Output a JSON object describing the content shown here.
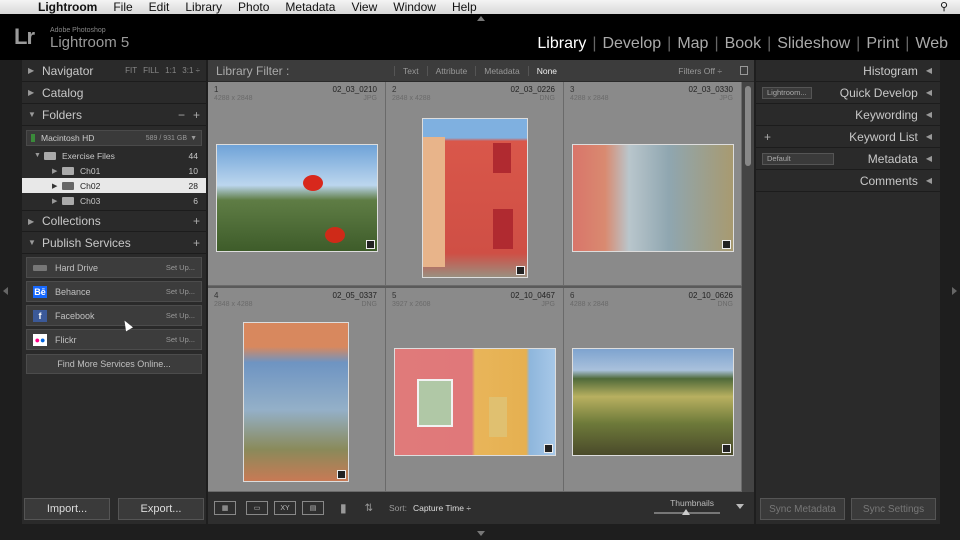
{
  "menubar": {
    "app": "Lightroom",
    "items": [
      "File",
      "Edit",
      "Library",
      "Photo",
      "Metadata",
      "View",
      "Window",
      "Help"
    ]
  },
  "branding": {
    "logo": "Lr",
    "small": "Adobe Photoshop",
    "big": "Lightroom 5"
  },
  "modules": [
    "Library",
    "Develop",
    "Map",
    "Book",
    "Slideshow",
    "Print",
    "Web"
  ],
  "left_panel": {
    "navigator": {
      "title": "Navigator",
      "zoom": [
        "FIT",
        "FILL",
        "1:1",
        "3:1 ÷"
      ]
    },
    "catalog": "Catalog",
    "folders": {
      "title": "Folders",
      "drive": {
        "name": "Macintosh HD",
        "capacity": "589 / 931 GB"
      },
      "items": [
        {
          "name": "Exercise Files",
          "count": "44"
        },
        {
          "name": "Ch01",
          "count": "10"
        },
        {
          "name": "Ch02",
          "count": "28"
        },
        {
          "name": "Ch03",
          "count": "6"
        }
      ]
    },
    "collections": "Collections",
    "publish": {
      "title": "Publish Services",
      "services": [
        {
          "name": "Hard Drive",
          "setup": "Set Up..."
        },
        {
          "name": "Behance",
          "setup": "Set Up..."
        },
        {
          "name": "Facebook",
          "setup": "Set Up..."
        },
        {
          "name": "Flickr",
          "setup": "Set Up..."
        }
      ],
      "find_more": "Find More Services Online..."
    },
    "import": "Import...",
    "export": "Export..."
  },
  "right_panel": {
    "histogram": "Histogram",
    "quick_develop": {
      "title": "Quick Develop",
      "preset": "Lightroom..."
    },
    "keywording": "Keywording",
    "keyword_list": "Keyword List",
    "metadata": {
      "title": "Metadata",
      "preset": "Default"
    },
    "comments": "Comments",
    "sync_metadata": "Sync Metadata",
    "sync_settings": "Sync Settings"
  },
  "filter": {
    "title": "Library Filter :",
    "tabs": [
      "Text",
      "Attribute",
      "Metadata",
      "None"
    ],
    "active": "None",
    "filters_off": "Filters Off ÷"
  },
  "photos": [
    {
      "num": "1",
      "file": "02_03_0210",
      "dims": "4288 x 2848",
      "ext": "JPG"
    },
    {
      "num": "2",
      "file": "02_03_0226",
      "dims": "2848 x 4288",
      "ext": "DNG"
    },
    {
      "num": "3",
      "file": "02_03_0330",
      "dims": "4288 x 2848",
      "ext": "JPG"
    },
    {
      "num": "4",
      "file": "02_05_0337",
      "dims": "2848 x 4288",
      "ext": "DNG"
    },
    {
      "num": "5",
      "file": "02_10_0467",
      "dims": "3927 x 2608",
      "ext": "JPG"
    },
    {
      "num": "6",
      "file": "02_10_0626",
      "dims": "4288 x 2848",
      "ext": "DNG"
    }
  ],
  "toolbar": {
    "sort_label": "Sort:",
    "sort_value": "Capture Time ÷",
    "thumbnails": "Thumbnails"
  },
  "colors": {
    "accent_active": "#ffffff",
    "panel_bg": "#2a2a2a",
    "grid_cell": "#8a8a8a"
  }
}
